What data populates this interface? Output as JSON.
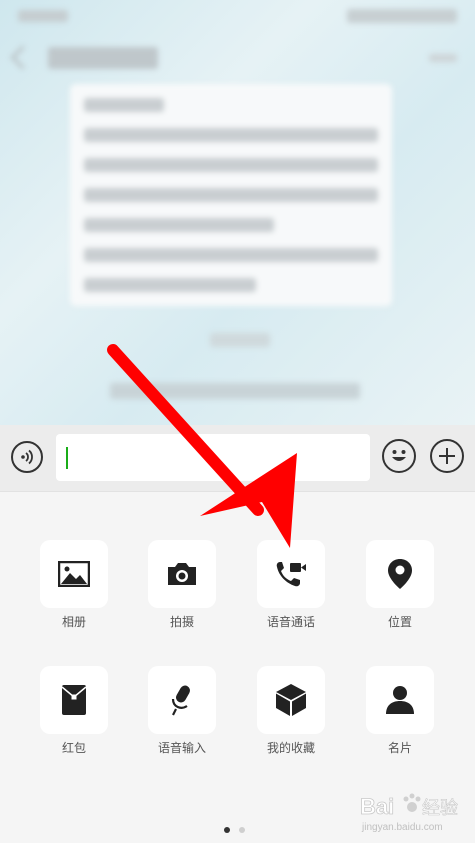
{
  "input": {
    "value": "",
    "placeholder": ""
  },
  "panel": {
    "row1": [
      {
        "label": "相册",
        "icon": "image-icon"
      },
      {
        "label": "拍摄",
        "icon": "camera-icon"
      },
      {
        "label": "语音通话",
        "icon": "video-call-icon"
      },
      {
        "label": "位置",
        "icon": "location-pin-icon"
      }
    ],
    "row2": [
      {
        "label": "红包",
        "icon": "red-packet-icon"
      },
      {
        "label": "语音输入",
        "icon": "microphone-icon"
      },
      {
        "label": "我的收藏",
        "icon": "cube-icon"
      },
      {
        "label": "名片",
        "icon": "person-card-icon"
      }
    ],
    "page_indicator": {
      "current": 1,
      "total": 2
    }
  },
  "watermark": {
    "brand": "Baidu 经验",
    "url": "jingyan.baidu.com"
  },
  "colors": {
    "annotation_arrow": "#ff0000",
    "caret": "#1aad19",
    "panel_bg": "#f5f5f5"
  }
}
